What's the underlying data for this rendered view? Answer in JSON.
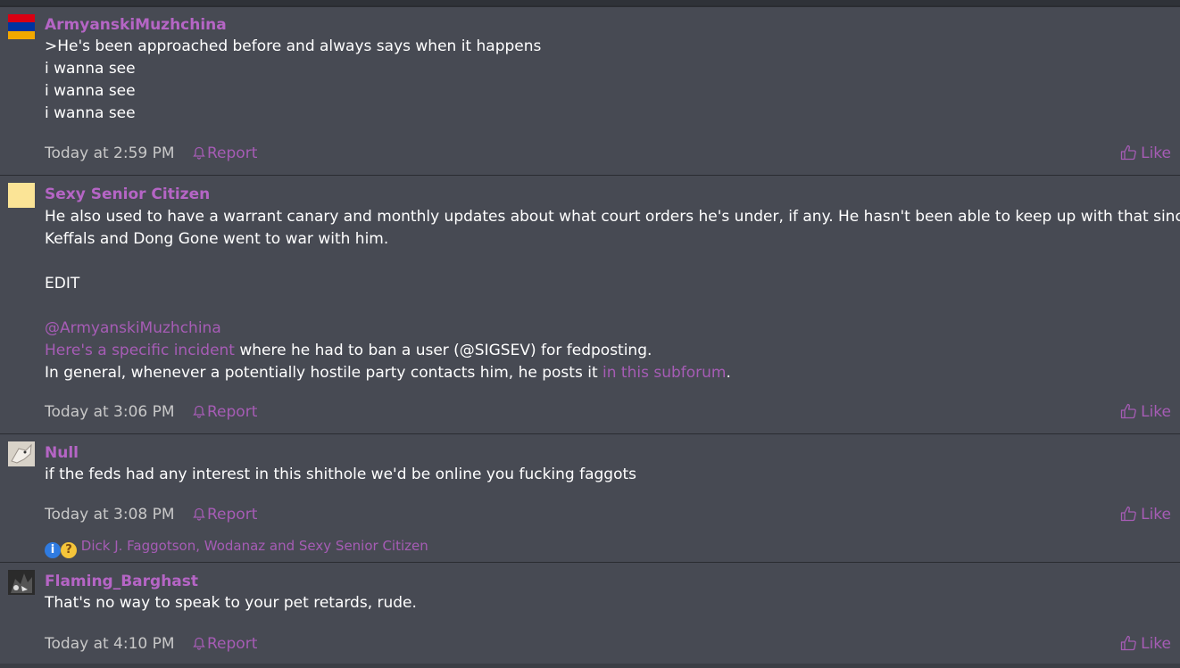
{
  "posts": [
    {
      "author": "ArmyanskiMuzhchina",
      "lines": [
        ">He's been approached before and always says when it happens",
        "i wanna see",
        "i wanna see",
        "i wanna see"
      ],
      "time": "Today at 2:59 PM",
      "report": "Report",
      "like": "Like"
    },
    {
      "author": "Sexy Senior Citizen",
      "lines": [
        "He also used to have a warrant canary and monthly updates about what court orders he's under, if any. He hasn't been able to keep up with that since",
        "Keffals and Dong Gone went to war with him.",
        "EDIT",
        "@ArmyanskiMuzhchina"
      ],
      "line5_link": "Here's a specific incident",
      "line5_rest": " where he had to ban a user (@SIGSEV) for fedposting.",
      "line6_text": "In general, whenever a potentially hostile party contacts him, he posts it ",
      "line6_link": "in this subforum",
      "line6_end": ".",
      "time": "Today at 3:06 PM",
      "report": "Report",
      "like": "Like"
    },
    {
      "author": "Null",
      "lines": [
        "if the feds had any interest in this shithole we'd be online you fucking faggots"
      ],
      "time": "Today at 3:08 PM",
      "report": "Report",
      "like": "Like",
      "reactions": "Dick J. Faggotson, Wodanaz and Sexy Senior Citizen"
    },
    {
      "author": "Flaming_Barghast",
      "lines": [
        "That's no way to speak to your pet retards, rude."
      ],
      "time": "Today at 4:10 PM",
      "report": "Report",
      "like": "Like"
    }
  ],
  "colors": {
    "accent": "#a65cb5",
    "author": "#b565c5",
    "post_bg": "#474a53"
  }
}
